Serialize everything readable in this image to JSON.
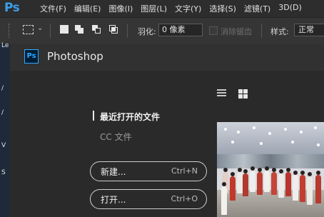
{
  "app": {
    "logo": "Ps"
  },
  "menu": [
    "文件(F)",
    "编辑(E)",
    "图像(I)",
    "图层(L)",
    "文字(Y)",
    "选择(S)",
    "滤镜(T)",
    "3D(D)"
  ],
  "options": {
    "feather_label": "羽化:",
    "feather_value": "0 像素",
    "antialias_label": "消除锯齿",
    "style_label": "样式:",
    "style_value": "正常"
  },
  "toolstrip": [
    "Le",
    "/",
    "/",
    "V",
    "S"
  ],
  "home": {
    "logo": "Ps",
    "title": "Photoshop",
    "recent_label": "最近打开的文件",
    "cc_label": "CC 文件",
    "new_label": "新建...",
    "new_shortcut": "Ctrl+N",
    "open_label": "打开...",
    "open_shortcut": "Ctrl+O"
  },
  "colors": {
    "accent": "#31a8ff",
    "background": "#2b2b2b",
    "frame": "#b48cc0"
  }
}
